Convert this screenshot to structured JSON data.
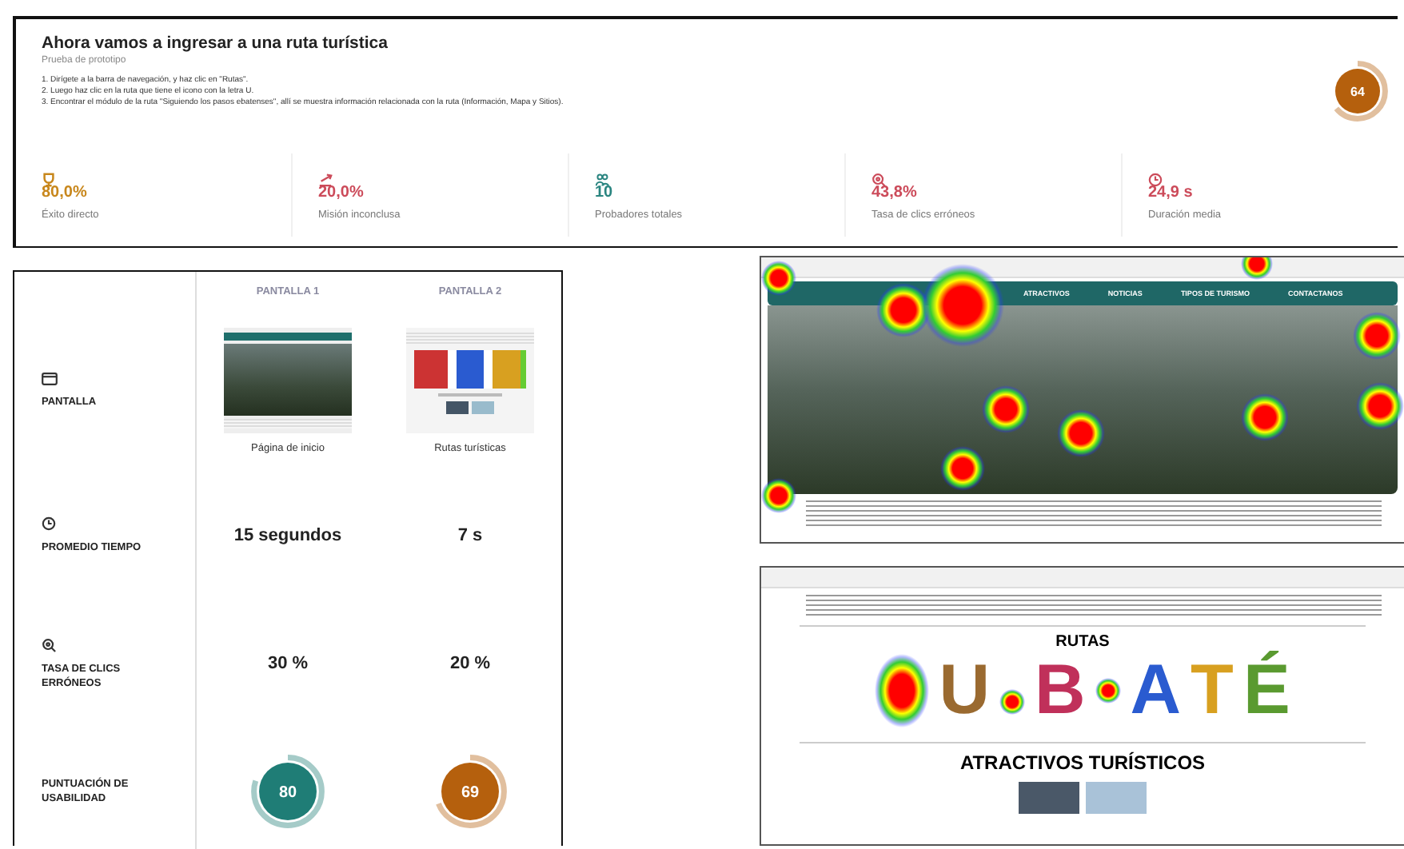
{
  "task": {
    "title": "Ahora vamos a ingresar a una ruta turística",
    "subtitle": "Prueba de prototipo",
    "steps": [
      "1. Dirígete a la barra de navegación, y haz clic en \"Rutas\".",
      "2. Luego haz clic en la ruta que tiene el icono con la letra U.",
      "3. Encontrar el módulo de la ruta \"Siguiendo los pasos ebatenses\", allí se muestra información relacionada con la ruta (Información, Mapa y Sitios)."
    ],
    "score": {
      "value": "64",
      "level": 0.64,
      "color": "#b5600d"
    }
  },
  "metrics": [
    {
      "kind": "trophy",
      "value": "80,0%",
      "label": "Éxito directo",
      "color": "#c8871c"
    },
    {
      "kind": "exit",
      "value": "20,0%",
      "label": "Misión inconclusa",
      "color": "#cc4b5a"
    },
    {
      "kind": "people",
      "value": "10",
      "label": "Probadores totales",
      "color": "#2a8580"
    },
    {
      "kind": "misclick",
      "value": "43,8%",
      "label": "Tasa de clics erróneos",
      "color": "#cc4b5a"
    },
    {
      "kind": "clock",
      "value": "24,9 s",
      "label": "Duración media",
      "color": "#cc4b5a"
    }
  ],
  "comparison": {
    "columns": [
      "PANTALLA 1",
      "PANTALLA 2"
    ],
    "rows": [
      {
        "kind": "screens",
        "label": "PANTALLA",
        "cells": [
          {
            "kind": "home",
            "caption": "Página de inicio"
          },
          {
            "kind": "routes",
            "caption": "Rutas turísticas"
          }
        ]
      },
      {
        "kind": "text",
        "label": "PROMEDIO TIEMPO",
        "cells": [
          "15 segundos",
          "7 s"
        ]
      },
      {
        "kind": "text",
        "label": "TASA DE CLICS ERRÓNEOS",
        "cells": [
          "30 %",
          "20 %"
        ]
      },
      {
        "kind": "score",
        "label": "PUNTUACIÓN DE USABILIDAD",
        "cells": [
          {
            "value": "80",
            "level": 0.8,
            "color": "#1f7d76"
          },
          {
            "value": "69",
            "level": 0.69,
            "color": "#b5600d"
          }
        ]
      }
    ]
  },
  "heatmaps": [
    {
      "kind": "home",
      "nav": [
        "ATRACTIVOS",
        "NOTICIAS",
        "TIPOS DE TURISMO",
        "CONTACTANOS"
      ]
    },
    {
      "kind": "routes",
      "heading": "RUTAS",
      "letters": [
        "U",
        "B",
        "A",
        "T",
        "É"
      ],
      "section": "ATRACTIVOS TURÍSTICOS"
    }
  ]
}
